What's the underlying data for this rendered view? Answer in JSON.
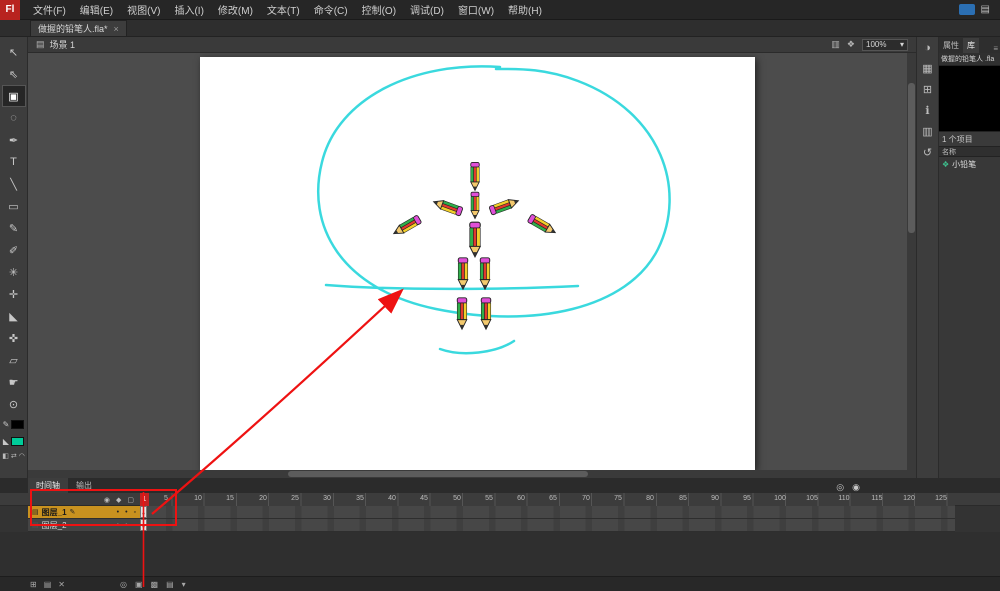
{
  "colors": {
    "accent_red": "#ee1212",
    "drawing_cyan": "#3ad9de",
    "layer_selected": "#c9921f",
    "fill_swatch": "#00cc99",
    "stroke_swatch": "#000000"
  },
  "menubar": {
    "logo": "Fl",
    "items": [
      "文件(F)",
      "编辑(E)",
      "视图(V)",
      "插入(I)",
      "修改(M)",
      "文本(T)",
      "命令(C)",
      "控制(O)",
      "调试(D)",
      "窗口(W)",
      "帮助(H)"
    ]
  },
  "tabbar": {
    "document_title": "做握的铅笔人.fla*",
    "close": "×"
  },
  "editbar": {
    "scene_icon": "▤",
    "scene": "场景 1",
    "edit_scene_icon": "▥",
    "edit_symbols_icon": "❖",
    "zoom": "100%",
    "zoom_caret": "▾"
  },
  "toolbar": {
    "tools": [
      {
        "name": "selection-tool",
        "glyph": "↖"
      },
      {
        "name": "subselection-tool",
        "glyph": "⇖"
      },
      {
        "name": "free-transform-tool",
        "glyph": "▣"
      },
      {
        "name": "lasso-tool",
        "glyph": "◌"
      },
      {
        "name": "pen-tool",
        "glyph": "✒"
      },
      {
        "name": "text-tool",
        "glyph": "T"
      },
      {
        "name": "line-tool",
        "glyph": "╲"
      },
      {
        "name": "rectangle-tool",
        "glyph": "▭"
      },
      {
        "name": "pencil-tool",
        "glyph": "✎"
      },
      {
        "name": "brush-tool",
        "glyph": "✐"
      },
      {
        "name": "deco-tool",
        "glyph": "✳"
      },
      {
        "name": "bone-tool",
        "glyph": "✛"
      },
      {
        "name": "paint-bucket-tool",
        "glyph": "◣"
      },
      {
        "name": "eyedropper-tool",
        "glyph": "✜"
      },
      {
        "name": "eraser-tool",
        "glyph": "▱"
      },
      {
        "name": "hand-tool",
        "glyph": "☛"
      },
      {
        "name": "zoom-tool",
        "glyph": "⊙"
      }
    ],
    "stroke_glyph": "✎",
    "fill_glyph": "◣",
    "options": [
      {
        "name": "default-colors-button",
        "glyph": "◧"
      },
      {
        "name": "swap-colors-button",
        "glyph": "⇄"
      },
      {
        "name": "snap-button",
        "glyph": "◠"
      }
    ]
  },
  "panelstrip": {
    "icons": [
      {
        "name": "color-panel-icon",
        "glyph": "◑"
      },
      {
        "name": "swatches-panel-icon",
        "glyph": "▦"
      },
      {
        "name": "align-panel-icon",
        "glyph": "⊞"
      },
      {
        "name": "info-panel-icon",
        "glyph": "ℹ"
      },
      {
        "name": "transform-panel-icon",
        "glyph": "▥"
      },
      {
        "name": "history-panel-icon",
        "glyph": "↺"
      }
    ]
  },
  "library": {
    "tabs": [
      "属性",
      "库"
    ],
    "panel_menu": "≡",
    "document_select": "做握的铅笔人 .fla",
    "item_count": "1 个项目",
    "name_header": "名称",
    "items": [
      {
        "icon": "❖",
        "name": "小铅笔"
      }
    ]
  },
  "timeline": {
    "tabs": [
      "时间轴",
      "输出"
    ],
    "tab_row_icons": [
      {
        "name": "center-frame-icon",
        "glyph": "◎"
      },
      {
        "name": "loop-icon",
        "glyph": "◉"
      }
    ],
    "header_icons": [
      {
        "name": "eye-icon",
        "glyph": "◉"
      },
      {
        "name": "lock-icon",
        "glyph": "◆"
      },
      {
        "name": "outline-icon",
        "glyph": "▢"
      }
    ],
    "playhead_frame": "1",
    "ruler_labels": [
      "5",
      "10",
      "15",
      "20",
      "25",
      "30",
      "35",
      "40",
      "45",
      "50",
      "55",
      "60",
      "65",
      "70",
      "75",
      "80",
      "85",
      "90",
      "95",
      "100",
      "105",
      "110",
      "115",
      "120",
      "125"
    ],
    "keyframe_dot": "●",
    "layers": [
      {
        "layer_icon": "▤",
        "name": "图层_1",
        "edit_glyph": "✎",
        "vis": "•",
        "lock": "•",
        "outline": "▫"
      },
      {
        "layer_icon": "▤",
        "name": "图层_2",
        "edit_glyph": "",
        "vis": "•",
        "lock": "•",
        "outline": "▫"
      }
    ],
    "bottom_left_icons": [
      {
        "name": "new-layer-icon",
        "glyph": "⊞"
      },
      {
        "name": "new-folder-icon",
        "glyph": "▤"
      },
      {
        "name": "delete-layer-icon",
        "glyph": "✕"
      }
    ],
    "bottom_center_icons": [
      {
        "name": "center-frame-button-icon",
        "glyph": "◎"
      },
      {
        "name": "onion-skin-icon",
        "glyph": "▣"
      },
      {
        "name": "onion-skin-outline-icon",
        "glyph": "▩"
      },
      {
        "name": "edit-multiple-frames-icon",
        "glyph": "▤"
      },
      {
        "name": "modify-markers-icon",
        "glyph": "▾"
      }
    ]
  }
}
